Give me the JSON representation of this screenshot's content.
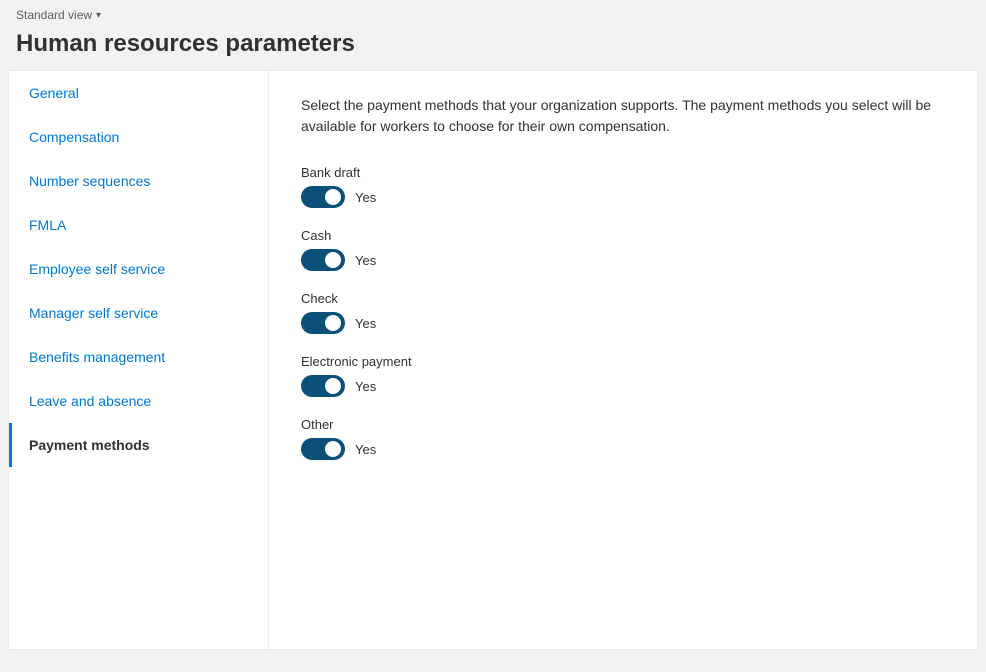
{
  "topbar": {
    "view_label": "Standard view",
    "chevron": "▾"
  },
  "header": {
    "title": "Human resources parameters"
  },
  "sidebar": {
    "items": [
      {
        "id": "general",
        "label": "General",
        "active": false
      },
      {
        "id": "compensation",
        "label": "Compensation",
        "active": false
      },
      {
        "id": "number-sequences",
        "label": "Number sequences",
        "active": false
      },
      {
        "id": "fmla",
        "label": "FMLA",
        "active": false
      },
      {
        "id": "employee-self-service",
        "label": "Employee self service",
        "active": false
      },
      {
        "id": "manager-self-service",
        "label": "Manager self service",
        "active": false
      },
      {
        "id": "benefits-management",
        "label": "Benefits management",
        "active": false
      },
      {
        "id": "leave-and-absence",
        "label": "Leave and absence",
        "active": false
      },
      {
        "id": "payment-methods",
        "label": "Payment methods",
        "active": true
      }
    ]
  },
  "content": {
    "description": "Select the payment methods that your organization supports. The payment methods you select will be available for workers to choose for their own compensation.",
    "payment_options": [
      {
        "id": "bank-draft",
        "label": "Bank draft",
        "enabled": true,
        "value_label": "Yes"
      },
      {
        "id": "cash",
        "label": "Cash",
        "enabled": true,
        "value_label": "Yes"
      },
      {
        "id": "check",
        "label": "Check",
        "enabled": true,
        "value_label": "Yes"
      },
      {
        "id": "electronic-payment",
        "label": "Electronic payment",
        "enabled": true,
        "value_label": "Yes"
      },
      {
        "id": "other",
        "label": "Other",
        "enabled": true,
        "value_label": "Yes"
      }
    ]
  }
}
